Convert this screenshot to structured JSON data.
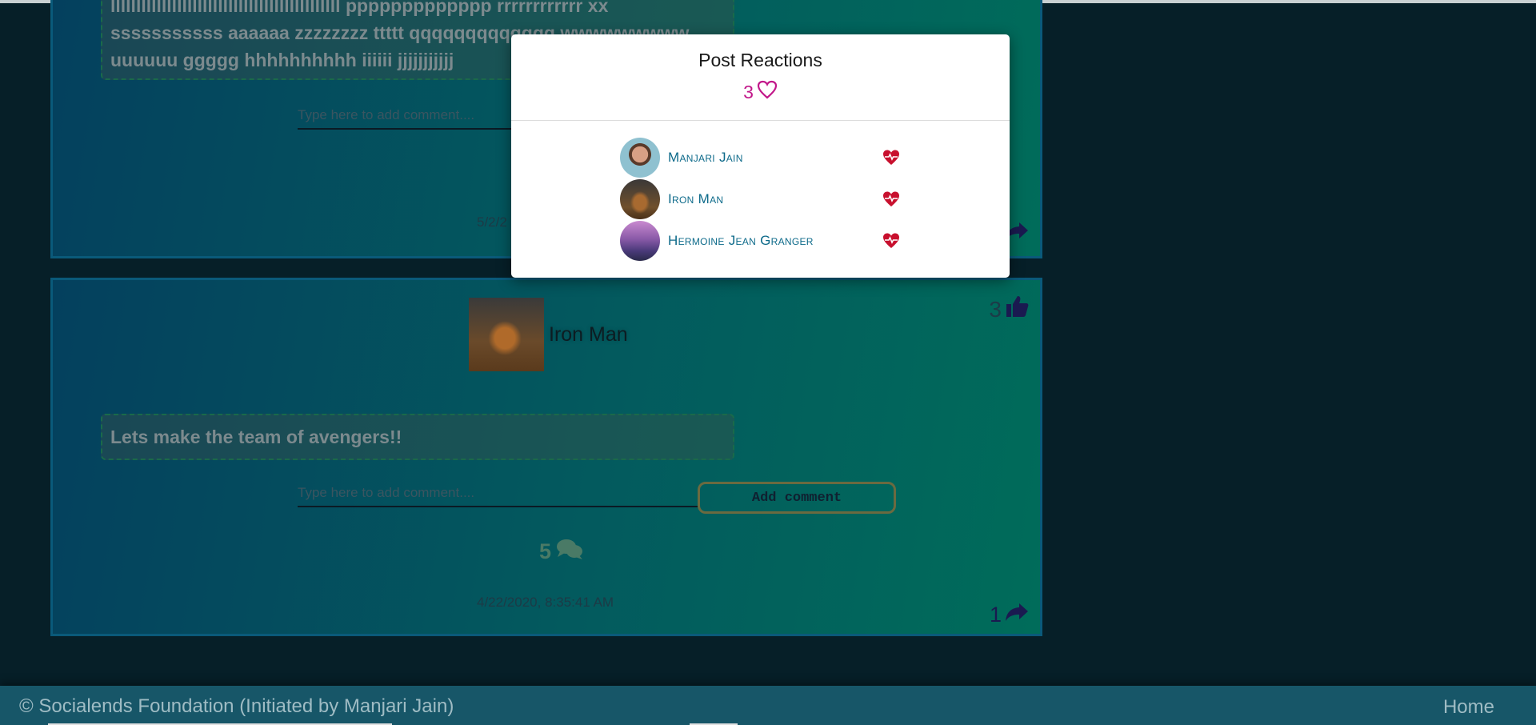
{
  "post1": {
    "text": "lllllllllllllllllllllllllllllllllllllllllllll ppppppppppppp rrrrrrrrrrrr xx sssssssssss aaaaaa zzzzzzzz ttttt qqqqqqqqqqqqq wwwwwwwww uuuuuu ggggg hhhhhhhhhh iiiiii jjjjjjjjjjj",
    "comment_placeholder": "Type here to add comment....",
    "timestamp": "5/2/2",
    "share_count": ""
  },
  "post2": {
    "author": "Iron Man",
    "likes": "3",
    "text": "Lets make the team of avengers!!",
    "comment_placeholder": "Type here to add comment....",
    "add_comment_label": "Add comment",
    "comments_count": "5",
    "timestamp": "4/22/2020, 8:35:41 AM",
    "share_count": "1"
  },
  "modal": {
    "title": "Post Reactions",
    "count": "3",
    "reactors": [
      {
        "name": "Manjari Jain",
        "reaction": "heart-pulse-icon"
      },
      {
        "name": "Iron Man",
        "reaction": "heart-pulse-icon"
      },
      {
        "name": "Hermoine Jean Granger",
        "reaction": "heart-pulse-icon"
      }
    ]
  },
  "footer": {
    "copyright": "© Socialends Foundation (Initiated by Manjari Jain)",
    "home_link": "Home"
  },
  "colors": {
    "accent_pink": "#c2188a",
    "reaction_red": "#c8102e",
    "name_blue": "#0d6a8a"
  }
}
